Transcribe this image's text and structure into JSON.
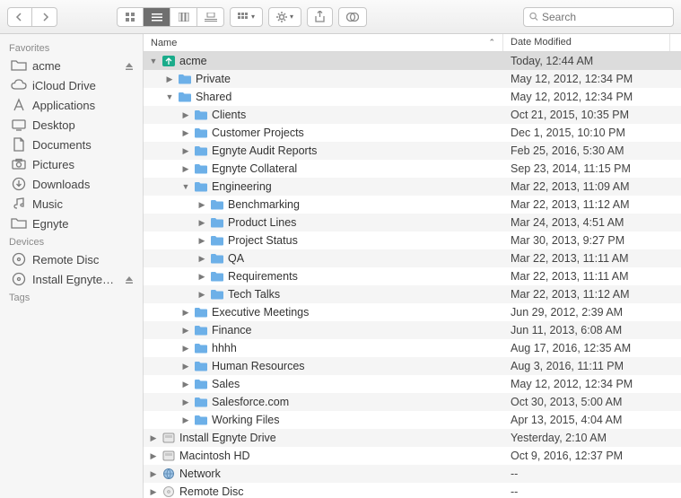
{
  "toolbar": {
    "search_placeholder": "Search"
  },
  "sidebar": {
    "sections": [
      {
        "title": "Favorites",
        "items": [
          {
            "label": "acme",
            "icon": "folder",
            "eject": true
          },
          {
            "label": "iCloud Drive",
            "icon": "cloud"
          },
          {
            "label": "Applications",
            "icon": "apps"
          },
          {
            "label": "Desktop",
            "icon": "desktop"
          },
          {
            "label": "Documents",
            "icon": "documents"
          },
          {
            "label": "Pictures",
            "icon": "pictures"
          },
          {
            "label": "Downloads",
            "icon": "downloads"
          },
          {
            "label": "Music",
            "icon": "music"
          },
          {
            "label": "Egnyte",
            "icon": "folder"
          }
        ]
      },
      {
        "title": "Devices",
        "items": [
          {
            "label": "Remote Disc",
            "icon": "disc"
          },
          {
            "label": "Install Egnyte…",
            "icon": "disc",
            "eject": true
          }
        ]
      },
      {
        "title": "Tags",
        "items": []
      }
    ]
  },
  "columns": {
    "name": "Name",
    "date": "Date Modified"
  },
  "rows": [
    {
      "indent": 0,
      "disclose": "down",
      "icon": "egnyte",
      "name": "acme",
      "date": "Today, 12:44 AM",
      "selected": true
    },
    {
      "indent": 1,
      "disclose": "right",
      "icon": "folder",
      "name": "Private",
      "date": "May 12, 2012, 12:34 PM"
    },
    {
      "indent": 1,
      "disclose": "down",
      "icon": "folder",
      "name": "Shared",
      "date": "May 12, 2012, 12:34 PM"
    },
    {
      "indent": 2,
      "disclose": "right",
      "icon": "folder",
      "name": "Clients",
      "date": "Oct 21, 2015, 10:35 PM"
    },
    {
      "indent": 2,
      "disclose": "right",
      "icon": "folder",
      "name": "Customer Projects",
      "date": "Dec 1, 2015, 10:10 PM"
    },
    {
      "indent": 2,
      "disclose": "right",
      "icon": "folder",
      "name": "Egnyte Audit Reports",
      "date": "Feb 25, 2016, 5:30 AM"
    },
    {
      "indent": 2,
      "disclose": "right",
      "icon": "folder",
      "name": "Egnyte Collateral",
      "date": "Sep 23, 2014, 11:15 PM"
    },
    {
      "indent": 2,
      "disclose": "down",
      "icon": "folder",
      "name": "Engineering",
      "date": "Mar 22, 2013, 11:09 AM"
    },
    {
      "indent": 3,
      "disclose": "right",
      "icon": "folder",
      "name": "Benchmarking",
      "date": "Mar 22, 2013, 11:12 AM"
    },
    {
      "indent": 3,
      "disclose": "right",
      "icon": "folder",
      "name": "Product Lines",
      "date": "Mar 24, 2013, 4:51 AM"
    },
    {
      "indent": 3,
      "disclose": "right",
      "icon": "folder",
      "name": "Project Status",
      "date": "Mar 30, 2013, 9:27 PM"
    },
    {
      "indent": 3,
      "disclose": "right",
      "icon": "folder",
      "name": "QA",
      "date": "Mar 22, 2013, 11:11 AM"
    },
    {
      "indent": 3,
      "disclose": "right",
      "icon": "folder",
      "name": "Requirements",
      "date": "Mar 22, 2013, 11:11 AM"
    },
    {
      "indent": 3,
      "disclose": "right",
      "icon": "folder",
      "name": "Tech Talks",
      "date": "Mar 22, 2013, 11:12 AM"
    },
    {
      "indent": 2,
      "disclose": "right",
      "icon": "folder",
      "name": "Executive Meetings",
      "date": "Jun 29, 2012, 2:39 AM"
    },
    {
      "indent": 2,
      "disclose": "right",
      "icon": "folder",
      "name": "Finance",
      "date": "Jun 11, 2013, 6:08 AM"
    },
    {
      "indent": 2,
      "disclose": "right",
      "icon": "folder",
      "name": "hhhh",
      "date": "Aug 17, 2016, 12:35 AM"
    },
    {
      "indent": 2,
      "disclose": "right",
      "icon": "folder",
      "name": "Human Resources",
      "date": "Aug 3, 2016, 11:11 PM"
    },
    {
      "indent": 2,
      "disclose": "right",
      "icon": "folder",
      "name": "Sales",
      "date": "May 12, 2012, 12:34 PM"
    },
    {
      "indent": 2,
      "disclose": "right",
      "icon": "folder",
      "name": "Salesforce.com",
      "date": "Oct 30, 2013, 5:00 AM"
    },
    {
      "indent": 2,
      "disclose": "right",
      "icon": "folder",
      "name": "Working Files",
      "date": "Apr 13, 2015, 4:04 AM"
    },
    {
      "indent": 0,
      "disclose": "right",
      "icon": "drive",
      "name": "Install Egnyte Drive",
      "date": "Yesterday, 2:10 AM"
    },
    {
      "indent": 0,
      "disclose": "right",
      "icon": "drive",
      "name": "Macintosh HD",
      "date": "Oct 9, 2016, 12:37 PM"
    },
    {
      "indent": 0,
      "disclose": "right",
      "icon": "network",
      "name": "Network",
      "date": "--"
    },
    {
      "indent": 0,
      "disclose": "right",
      "icon": "disc",
      "name": "Remote Disc",
      "date": "--"
    }
  ]
}
